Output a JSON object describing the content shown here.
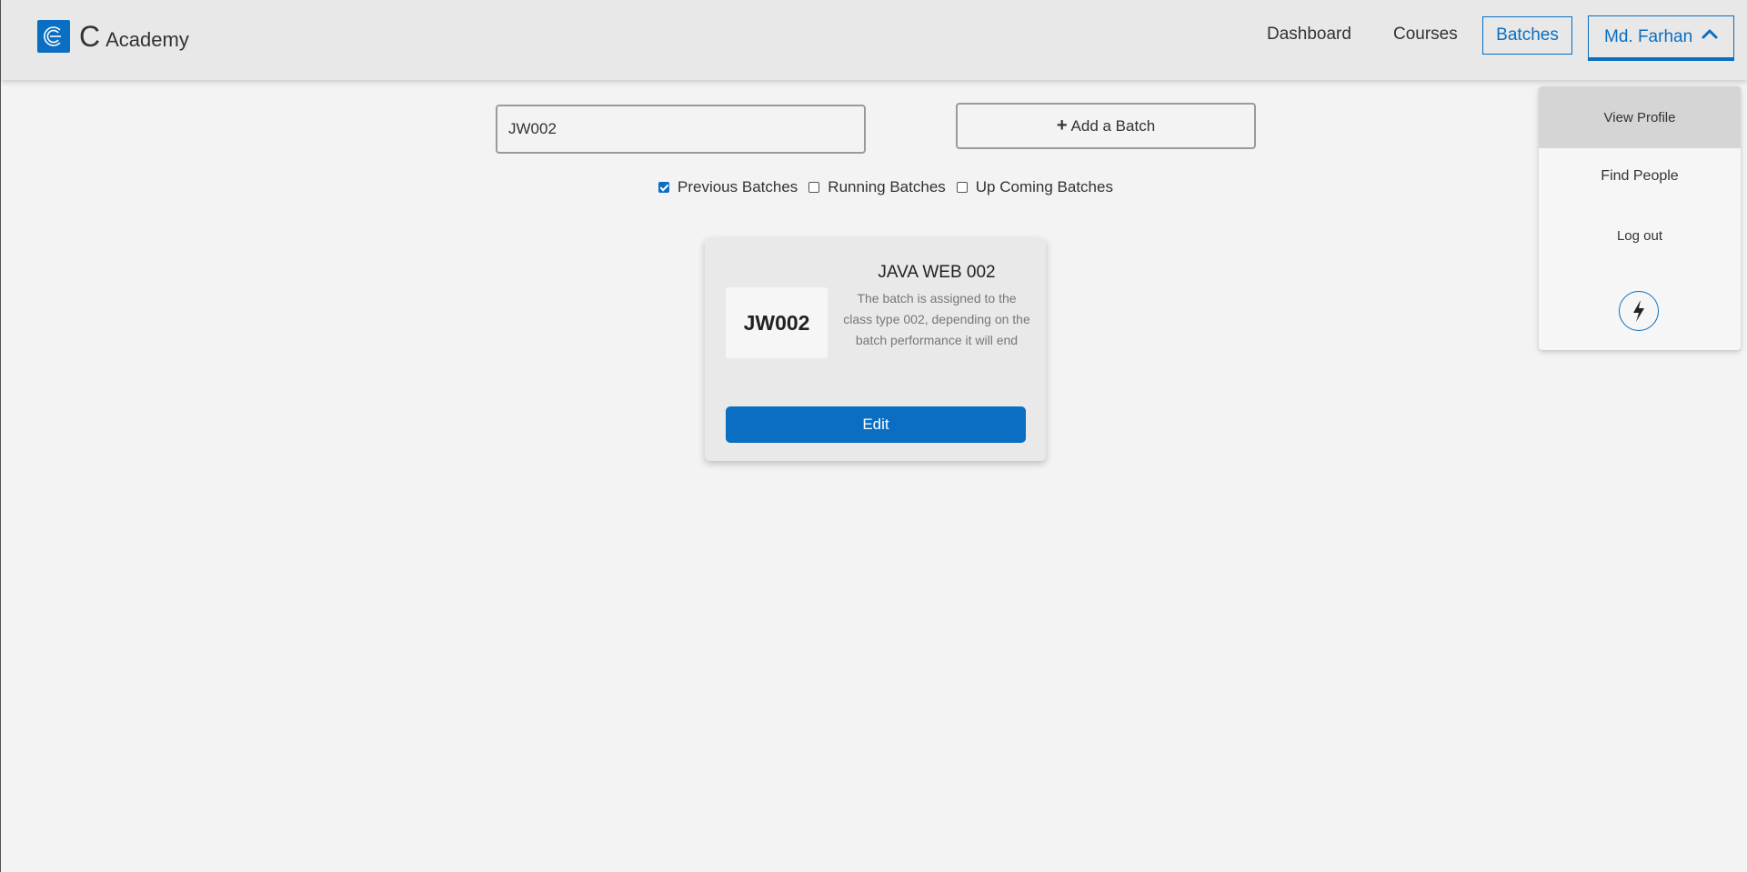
{
  "brand": {
    "letter": "C",
    "name": "Academy"
  },
  "nav": {
    "dashboard": "Dashboard",
    "courses": "Courses",
    "batches": "Batches",
    "user": "Md. Farhan"
  },
  "toolbar": {
    "search_value": "JW002",
    "add_batch_label": "Add a Batch"
  },
  "filters": [
    {
      "label": "Previous Batches",
      "checked": true
    },
    {
      "label": "Running Batches",
      "checked": false
    },
    {
      "label": "Up Coming Batches",
      "checked": false
    }
  ],
  "card": {
    "code": "JW002",
    "title": "JAVA WEB 002",
    "description": "The batch is assigned to the class type 002, depending on the batch performance it will end",
    "edit_label": "Edit"
  },
  "dropdown": {
    "view_profile": "View Profile",
    "find_people": "Find People",
    "log_out": "Log out"
  },
  "colors": {
    "accent": "#0a6fc2",
    "background": "#f3f3f3",
    "navbar": "#e8e8e8"
  }
}
